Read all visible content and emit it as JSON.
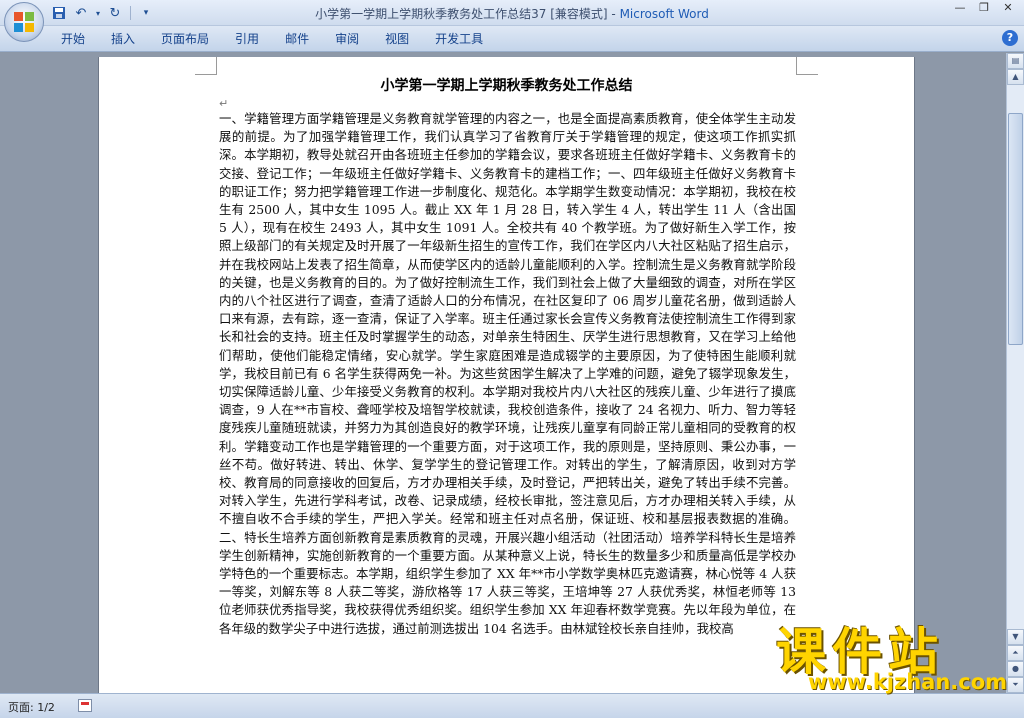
{
  "window": {
    "title": "小学第一学期上学期秋季教务处工作总结37 [兼容模式]",
    "separator": " - ",
    "app_name": "Microsoft Word"
  },
  "ribbon": {
    "tabs": [
      "开始",
      "插入",
      "页面布局",
      "引用",
      "邮件",
      "审阅",
      "视图",
      "开发工具"
    ]
  },
  "document": {
    "title": "小学第一学期上学期秋季教务处工作总结",
    "paragraph_mark": "↵",
    "body": "一、学籍管理方面学籍管理是义务教育就学管理的内容之一，也是全面提高素质教育，使全体学生主动发展的前提。为了加强学籍管理工作，我们认真学习了省教育厅关于学籍管理的规定，使这项工作抓实抓深。本学期初，教导处就召开由各班班主任参加的学籍会议，要求各班班主任做好学籍卡、义务教育卡的交接、登记工作；一年级班主任做好学籍卡、义务教育卡的建档工作；一、四年级班主任做好义务教育卡的职证工作；努力把学籍管理工作进一步制度化、规范化。本学期学生数变动情况：本学期初，我校在校生有 2500 人，其中女生 1095 人。截止 XX 年 1 月 28 日，转入学生 4 人，转出学生 11 人（含出国 5 人），现有在校生 2493 人，其中女生 1091 人。全校共有 40 个教学班。为了做好新生入学工作，按照上级部门的有关规定及时开展了一年级新生招生的宣传工作，我们在学区内八大社区粘贴了招生启示，并在我校网站上发表了招生简章，从而使学区内的适龄儿童能顺利的入学。控制流生是义务教育就学阶段的关键，也是义务教育的目的。为了做好控制流生工作，我们到社会上做了大量细致的调查，对所在学区内的八个社区进行了调查，查清了适龄人口的分布情况，在社区复印了 06 周岁儿童花名册，做到适龄人口来有源，去有踪，逐一查清，保证了入学率。班主任通过家长会宣传义务教育法使控制流生工作得到家长和社会的支持。班主任及时掌握学生的动态，对单亲生特困生、厌学生进行思想教育，又在学习上给他们帮助，使他们能稳定情绪，安心就学。学生家庭困难是造成辍学的主要原因，为了使特困生能顺利就学，我校目前已有 6 名学生获得两免一补。为这些贫困学生解决了上学难的问题，避免了辍学现象发生，切实保障适龄儿童、少年接受义务教育的权利。本学期对我校片内八大社区的残疾儿童、少年进行了摸底调查，9 人在**市盲校、聋哑学校及培智学校就读，我校创造条件，接收了 24 名视力、听力、智力等轻度残疾儿童随班就读，并努力为其创造良好的教学环境，让残疾儿童享有同龄正常儿童相同的受教育的权利。学籍变动工作也是学籍管理的一个重要方面，对于这项工作，我的原则是，坚持原则、秉公办事，一丝不苟。做好转进、转出、休学、复学学生的登记管理工作。对转出的学生，了解清原因，收到对方学校、教育局的同意接收的回复后，方才办理相关手续，及时登记，严把转出关，避免了转出手续不完善。对转入学生，先进行学科考试，改卷、记录成绩，经校长审批，签注意见后，方才办理相关转入手续，从不擅自收不合手续的学生，严把入学关。经常和班主任对点名册，保证班、校和基层报表数据的准确。二、特长生培养方面创新教育是素质教育的灵魂，开展兴趣小组活动（社团活动）培养学科特长生是培养学生创新精神，实施创新教育的一个重要方面。从某种意义上说，特长生的数量多少和质量高低是学校办学特色的一个重要标志。本学期，组织学生参加了 XX 年**市小学数学奥林匹克邀请赛，林心悦等 4 人获一等奖，刘解东等 8 人获二等奖，游欣格等 17 人获三等奖，王培坤等 27 人获优秀奖，林恒老师等 13 位老师获优秀指导奖，我校获得优秀组织奖。组织学生参加 XX 年迎春杯数学竞赛。先以年段为单位，在各年级的数学尖子中进行选拔，通过前测选拔出 104 名选手。由林斌铨校长亲自挂帅，我校高"
  },
  "status": {
    "page_label": "页面: 1/2"
  },
  "watermark": {
    "cn": "课件站",
    "url": "www.kjzhan.com"
  }
}
